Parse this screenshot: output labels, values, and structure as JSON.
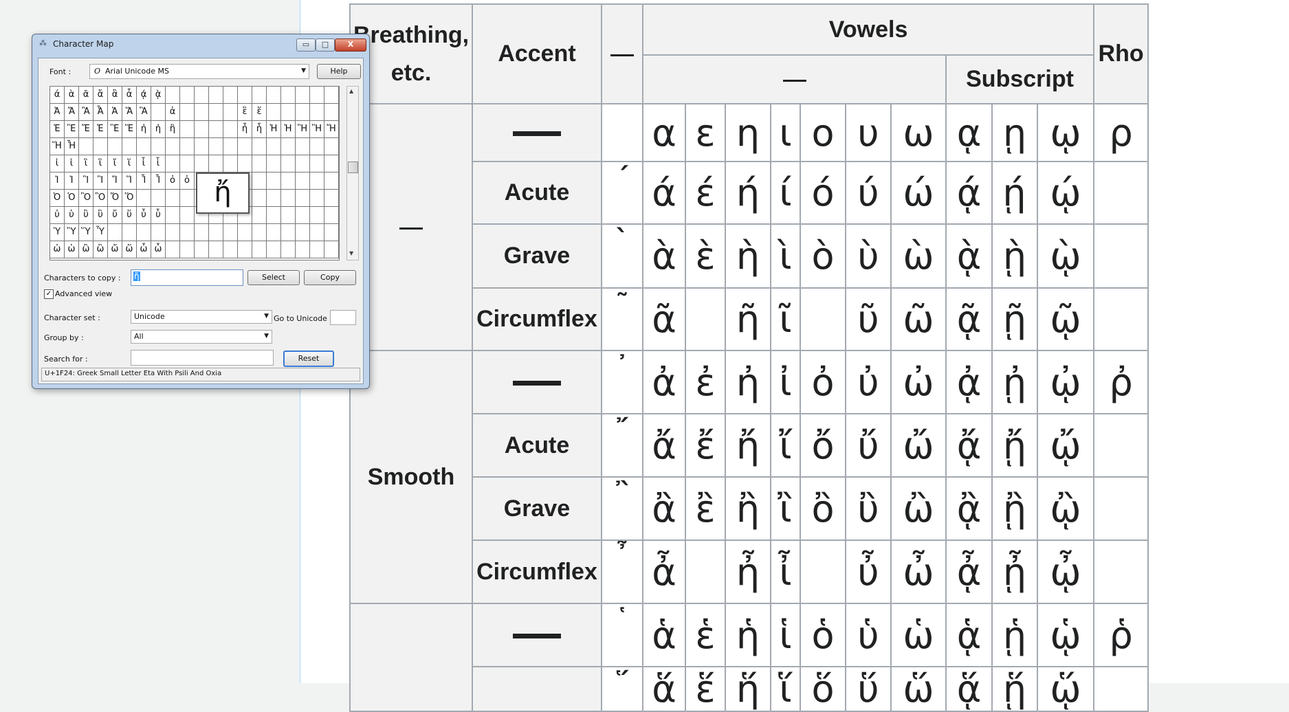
{
  "table": {
    "headers": {
      "breathing": "Breathing, etc.",
      "accent": "Accent",
      "vowels": "Vowels",
      "rho": "Rho",
      "subscript": "Subscript",
      "dash_symbol": "—"
    },
    "groups": [
      {
        "breathing": "—",
        "rows": [
          {
            "accent": "dash",
            "mark": "",
            "glyphs": [
              "α",
              "ε",
              "η",
              "ι",
              "ο",
              "υ",
              "ω",
              "ᾳ",
              "ῃ",
              "ῳ",
              "ρ"
            ]
          },
          {
            "accent": "Acute",
            "mark": "΄",
            "glyphs": [
              "ά",
              "έ",
              "ή",
              "ί",
              "ό",
              "ύ",
              "ώ",
              "ᾴ",
              "ῄ",
              "ῴ",
              ""
            ]
          },
          {
            "accent": "Grave",
            "mark": "`",
            "glyphs": [
              "ὰ",
              "ὲ",
              "ὴ",
              "ὶ",
              "ὸ",
              "ὺ",
              "ὼ",
              "ᾲ",
              "ῂ",
              "ῲ",
              ""
            ]
          },
          {
            "accent": "Circumflex",
            "mark": "῀",
            "glyphs": [
              "ᾶ",
              "",
              "ῆ",
              "ῖ",
              "",
              "ῦ",
              "ῶ",
              "ᾷ",
              "ῇ",
              "ῷ",
              ""
            ]
          }
        ]
      },
      {
        "breathing": "Smooth",
        "rows": [
          {
            "accent": "dash",
            "mark": "᾿",
            "glyphs": [
              "ἀ",
              "ἐ",
              "ἠ",
              "ἰ",
              "ὀ",
              "ὐ",
              "ὠ",
              "ᾀ",
              "ᾐ",
              "ᾠ",
              "ῤ"
            ]
          },
          {
            "accent": "Acute",
            "mark": "῎",
            "glyphs": [
              "ἄ",
              "ἔ",
              "ἤ",
              "ἴ",
              "ὄ",
              "ὔ",
              "ὤ",
              "ᾄ",
              "ᾔ",
              "ᾤ",
              ""
            ]
          },
          {
            "accent": "Grave",
            "mark": "῍",
            "glyphs": [
              "ἂ",
              "ἒ",
              "ἢ",
              "ἲ",
              "ὂ",
              "ὒ",
              "ὢ",
              "ᾂ",
              "ᾒ",
              "ᾢ",
              ""
            ]
          },
          {
            "accent": "Circumflex",
            "mark": "῏",
            "glyphs": [
              "ἆ",
              "",
              "ἦ",
              "ἶ",
              "",
              "ὖ",
              "ὦ",
              "ᾆ",
              "ᾖ",
              "ᾦ",
              ""
            ]
          }
        ]
      },
      {
        "breathing": "",
        "rows": [
          {
            "accent": "dash",
            "mark": "῾",
            "glyphs": [
              "ἁ",
              "ἑ",
              "ἡ",
              "ἱ",
              "ὁ",
              "ὑ",
              "ὡ",
              "ᾁ",
              "ᾑ",
              "ᾡ",
              "ῥ"
            ]
          },
          {
            "accent": "",
            "mark": "῞",
            "glyphs": [
              "ἅ",
              "ἕ",
              "ἥ",
              "ἵ",
              "ὅ",
              "ὕ",
              "ὥ",
              "ᾅ",
              "ᾕ",
              "ᾥ",
              ""
            ]
          }
        ]
      }
    ]
  },
  "charmap": {
    "title": "Character Map",
    "app_icon": "charmap-icon",
    "minimize": "▭",
    "maximize": "□",
    "close": "X",
    "font_label": "Font :",
    "font_value": "Arial Unicode MS",
    "font_icon": "O",
    "help_label": "Help",
    "grid_rows": [
      [
        "ά",
        "ὰ",
        "ᾶ",
        "ἄ",
        "ἂ",
        "ἆ",
        "ᾴ",
        "ᾲ",
        "",
        "",
        "",
        "",
        "",
        "",
        "",
        "",
        "",
        "",
        "",
        ""
      ],
      [
        "Ἀ",
        "Ἄ",
        "Ἂ",
        "Ἆ",
        "Ἁ",
        "Ἅ",
        "Ἃ",
        "",
        "ἀ",
        "",
        "",
        "",
        "",
        "ἓ",
        "ἕ",
        "",
        "",
        "",
        "",
        ""
      ],
      [
        "Ἐ",
        "Ἒ",
        "Ἔ",
        "Ἑ",
        "Ἓ",
        "Ἕ",
        "ἠ",
        "ἡ",
        "ἢ",
        "",
        "",
        "",
        "",
        "ἦ",
        "ἧ",
        "Ἠ",
        "Ἡ",
        "Ἢ",
        "Ἣ",
        "Ἤ"
      ],
      [
        "Ἥ",
        "Ἦ",
        "",
        "",
        "",
        "",
        "",
        "",
        "",
        "",
        "",
        "",
        "",
        "",
        "",
        "",
        "",
        "",
        "",
        ""
      ],
      [
        "ἰ",
        "ἱ",
        "ἲ",
        "ἳ",
        "ἴ",
        "ἵ",
        "ἶ",
        "ἷ",
        "",
        "",
        "",
        "",
        "",
        "",
        "",
        "",
        "",
        "",
        "",
        ""
      ],
      [
        "Ἰ",
        "Ἱ",
        "Ἲ",
        "Ἳ",
        "Ἴ",
        "Ἵ",
        "Ἶ",
        "Ἷ",
        "ὀ",
        "ὁ",
        "ὂ",
        "ὃ",
        "ὄ",
        "ὅ",
        "",
        "",
        "",
        "",
        "",
        ""
      ],
      [
        "Ὀ",
        "Ὁ",
        "Ὂ",
        "Ὃ",
        "Ὄ",
        "Ὅ",
        "",
        "",
        "",
        "",
        "",
        "",
        "",
        "",
        "",
        "",
        "",
        "",
        "",
        ""
      ],
      [
        "ὐ",
        "ὑ",
        "ὒ",
        "ὓ",
        "ὔ",
        "ὕ",
        "ὖ",
        "ὗ",
        "",
        "",
        "",
        "",
        "",
        "",
        "",
        "",
        "",
        "",
        "",
        ""
      ],
      [
        "Ὑ",
        "Ὓ",
        "Ὕ",
        "Ὗ",
        "",
        "",
        "",
        "",
        "",
        "",
        "",
        "",
        "",
        "",
        "",
        "",
        "",
        "",
        "",
        ""
      ],
      [
        "ὠ",
        "ὡ",
        "ὢ",
        "ὣ",
        "ὤ",
        "ὥ",
        "ὦ",
        "ὧ",
        "",
        "",
        "",
        "",
        "",
        "",
        "",
        "",
        "",
        "",
        "",
        ""
      ]
    ],
    "zoom_glyph": "ἤ",
    "chars_to_copy_label": "Characters to copy :",
    "chars_to_copy_value": "ἤ",
    "select_label": "Select",
    "copy_label": "Copy",
    "advanced_label": "Advanced view",
    "advanced_check": "✓",
    "charset_label": "Character set :",
    "charset_value": "Unicode",
    "goto_label": "Go to Unicode :",
    "groupby_label": "Group by :",
    "groupby_value": "All",
    "search_label": "Search for :",
    "reset_label": "Reset",
    "status": "U+1F24: Greek Small Letter Eta With Psili And Oxia"
  }
}
